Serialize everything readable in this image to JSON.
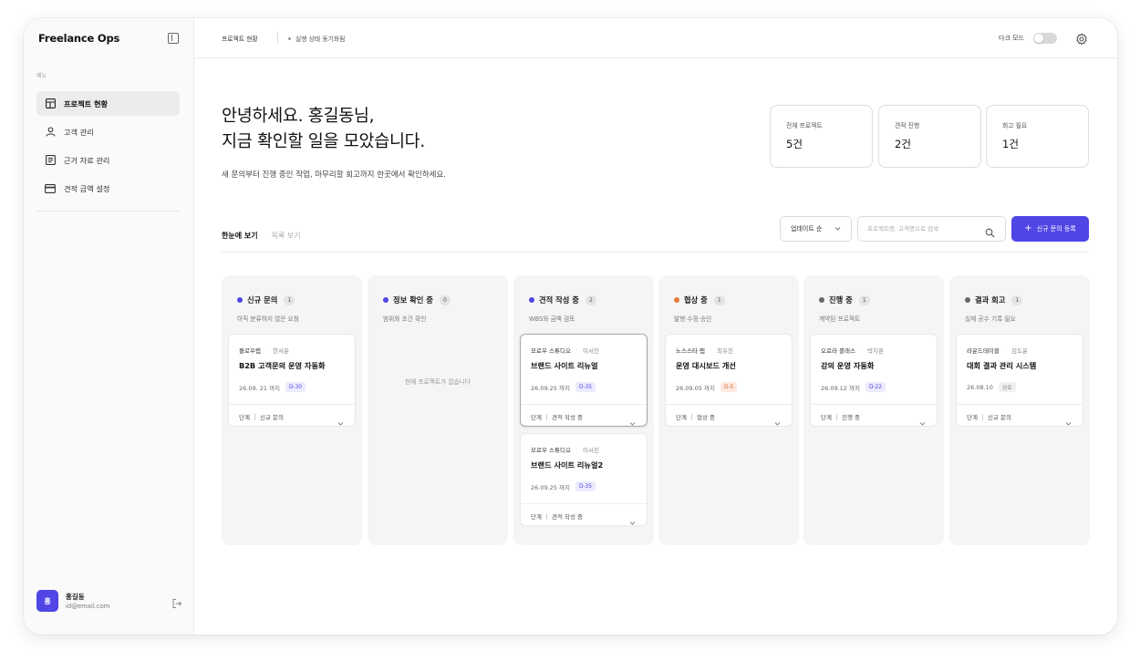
{
  "sidebar": {
    "brand": "Freelance Ops",
    "menu_caption": "메뉴",
    "items": [
      {
        "label": "프로젝트 현황",
        "icon": "layout-icon"
      },
      {
        "label": "고객 관리",
        "icon": "user-icon"
      },
      {
        "label": "근거 자료 관리",
        "icon": "document-icon"
      },
      {
        "label": "견적 금액 설정",
        "icon": "card-icon"
      }
    ],
    "user": {
      "initial": "홍",
      "name": "홍길동",
      "email": "id@email.com"
    }
  },
  "topbar": {
    "title": "프로젝트 현황",
    "sync_status": "실행 상태 동기화됨",
    "dark_mode_label": "다크 모드",
    "dark_mode_on": false
  },
  "hero": {
    "greeting_line1": "안녕하세요. 홍길동님,",
    "greeting_line2": "지금 확인할 일을 모았습니다.",
    "subtitle": "새 문의부터 진행 중인 작업, 마무리할 회고까지 한곳에서 확인하세요."
  },
  "stats": [
    {
      "label": "전체 프로젝트",
      "value": "5건"
    },
    {
      "label": "견적 진행",
      "value": "2건"
    },
    {
      "label": "회고 필요",
      "value": "1건"
    }
  ],
  "view_tabs": [
    "한눈에 보기",
    "목록 보기"
  ],
  "toolbar": {
    "sort_label": "업데이트 순",
    "search_placeholder": "프로젝트명, 고객명으로 검색",
    "new_button_label": "신규 문의 등록"
  },
  "colors": {
    "accent": "#4f46e5",
    "dot_blue": "#4f46e5",
    "dot_orange": "#e8793a",
    "dot_gray": "#666666"
  },
  "columns": [
    {
      "title": "신규 문의",
      "count": "1",
      "desc": "아직 분류하지 않은 요청",
      "dot": "#4f46e5",
      "cards": [
        {
          "client": "플로우랩",
          "contact": "한서윤",
          "title": "B2B 고객문의 운영 자동화",
          "due": "26.09. 21 까지",
          "dday": "D-30",
          "stage_label": "단계",
          "stage": "신규 문의"
        }
      ]
    },
    {
      "title": "정보 확인 중",
      "count": "0",
      "desc": "범위와 조건 확인",
      "dot": "#4f46e5",
      "empty_text": "현재 프로젝트가 없습니다",
      "cards": []
    },
    {
      "title": "견적 작성 중",
      "count": "2",
      "desc": "WBS와 금액 검토",
      "dot": "#4f46e5",
      "cards": [
        {
          "client": "모로우 스튜디오",
          "contact": "이서진",
          "title": "브랜드 사이트 리뉴얼",
          "due": "26.09.25 까지",
          "dday": "D-35",
          "stage_label": "단계",
          "stage": "견적 작성 중"
        },
        {
          "client": "모로우 스튜디오",
          "contact": "이서진",
          "title": "브랜드 사이트 리뉴얼2",
          "due": "26.09.25 까지",
          "dday": "D-35",
          "stage_label": "단계",
          "stage": "견적 작성 중"
        }
      ]
    },
    {
      "title": "협상 중",
      "count": "1",
      "desc": "발행·수정·승인",
      "dot": "#e8793a",
      "cards": [
        {
          "client": "노스스타 랩",
          "contact": "최유진",
          "title": "운영 대시보드 개선",
          "due": "26.09.05 까지",
          "dday": "D-5",
          "stage_label": "단계",
          "stage": "협상 중"
        }
      ]
    },
    {
      "title": "진행 중",
      "count": "1",
      "desc": "계약된 프로젝트",
      "dot": "#666666",
      "cards": [
        {
          "client": "오로라 클래스",
          "contact": "박지훈",
          "title": "강의 운영 자동화",
          "due": "26.09.12 까지",
          "dday": "D-22",
          "stage_label": "단계",
          "stage": "진행 중"
        }
      ]
    },
    {
      "title": "결과 회고",
      "count": "1",
      "desc": "실제 공수 기록 필요",
      "dot": "#666666",
      "cards": [
        {
          "client": "라운드테이블",
          "contact": "김도윤",
          "title": "대회 결과 관리 시스템",
          "due": "26.08.10",
          "dday": "완료",
          "stage_label": "단계",
          "stage": "신규 문의"
        }
      ]
    }
  ]
}
